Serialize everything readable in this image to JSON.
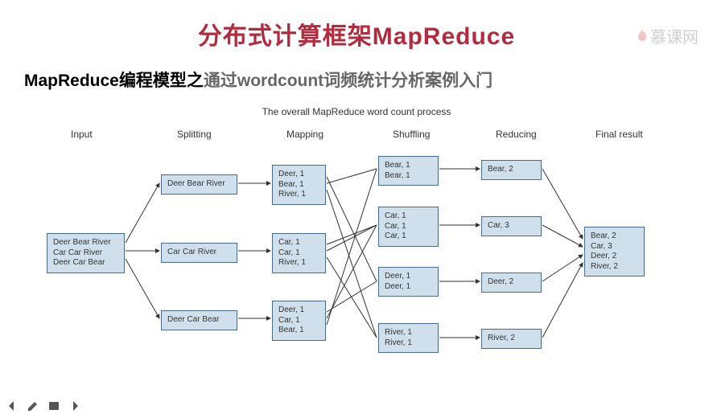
{
  "watermark": {
    "text": "慕课网"
  },
  "title": "分布式计算框架MapReduce",
  "subtitle": {
    "bold": "MapReduce编程模型之",
    "light": "通过wordcount词频统计分析案例入门"
  },
  "diagram": {
    "title": "The overall MapReduce word count process",
    "columns": [
      "Input",
      "Splitting",
      "Mapping",
      "Shuffling",
      "Reducing",
      "Final result"
    ],
    "input": {
      "lines": [
        "Deer Bear River",
        "Car Car River",
        "Deer Car Bear"
      ]
    },
    "splitting": [
      {
        "text": "Deer Bear River"
      },
      {
        "text": "Car Car River"
      },
      {
        "text": "Deer Car Bear"
      }
    ],
    "mapping": [
      {
        "lines": [
          "Deer, 1",
          "Bear, 1",
          "River, 1"
        ]
      },
      {
        "lines": [
          "Car, 1",
          "Car, 1",
          "River, 1"
        ]
      },
      {
        "lines": [
          "Deer, 1",
          "Car, 1",
          "Bear, 1"
        ]
      }
    ],
    "shuffling": [
      {
        "lines": [
          "Bear, 1",
          "Bear, 1"
        ]
      },
      {
        "lines": [
          "Car, 1",
          "Car, 1",
          "Car, 1"
        ]
      },
      {
        "lines": [
          "Deer, 1",
          "Deer, 1"
        ]
      },
      {
        "lines": [
          "River, 1",
          "River, 1"
        ]
      }
    ],
    "reducing": [
      {
        "text": "Bear, 2"
      },
      {
        "text": "Car, 3"
      },
      {
        "text": "Deer, 2"
      },
      {
        "text": "River, 2"
      }
    ],
    "final": {
      "lines": [
        "Bear, 2",
        "Car, 3",
        "Deer, 2",
        "River, 2"
      ]
    }
  },
  "toolbar": {
    "back": "back",
    "edit": "edit",
    "notes": "notes",
    "forward": "forward"
  }
}
